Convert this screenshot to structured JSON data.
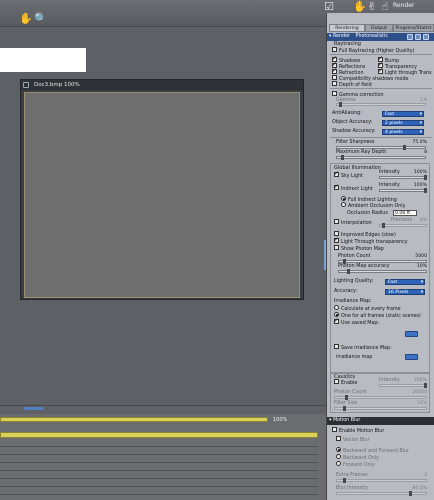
{
  "toolbar": {
    "title": "Render",
    "icons": [
      "hand-icon",
      "zoom-icon",
      "pose-hand-icon",
      "pose-hand-2-icon",
      "pose-hand-3-icon",
      "check-icon"
    ]
  },
  "document": {
    "title": "Doc3.bmp 100%"
  },
  "timeline": {
    "percent": "100%"
  },
  "panel": {
    "tabs": [
      "Rendering",
      "Output",
      "Progress/Statist"
    ],
    "header": "Render",
    "header_mode": "Photorealistic",
    "raytracing": {
      "title": "Raytracing",
      "full_raytracing": "Full Raytracing (Higher Quality)",
      "shadows": "Shadows",
      "bump": "Bump",
      "reflections": "Reflections",
      "transparency": "Transparency",
      "refraction": "Refraction",
      "light_through_trans": "Light through Trans",
      "compat_shadows": "Compatibility shadows mode",
      "depth_of_field": "Depth of field"
    },
    "gamma": {
      "label": "Gamma correction",
      "value_label": "Gamma:",
      "value": "1.8"
    },
    "antialiasing": {
      "label": "AntiAliasing:",
      "value": "Fast"
    },
    "object_accuracy": {
      "label": "Object Accuracy:",
      "value": "2 pixels"
    },
    "shadow_accuracy": {
      "label": "Shadow Accuracy:",
      "value": "4 pixels"
    },
    "filter_sharpness": {
      "label": "Filter Sharpness",
      "value": "75.0%"
    },
    "max_ray_depth": {
      "label": "Maximum Ray Depth",
      "value": "8"
    },
    "global_illum": {
      "title": "Global Illumination",
      "sky_light": "Sky Light",
      "intensity_label": "Intensity",
      "sky_intensity": "100%",
      "indirect_light": "Indirect Light",
      "indirect_intensity": "100%",
      "full_indirect": "Full Indirect Lighting",
      "ambient_occlusion": "Ambient Occlusion Only",
      "occlusion_radius_label": "Occlusion Radius",
      "occlusion_radius": "0.08 ft",
      "interpolation": "Interpolation",
      "precision_label": "Precision",
      "precision_value": "4%",
      "improved_edges": "Improved Edges (slow)",
      "light_through_transparency": "Light Through transparency",
      "show_photon_map": "Show Photon Map",
      "photon_count_label": "Photon Count",
      "photon_count": "5000",
      "photon_map_accuracy_label": "Photon Map accuracy",
      "photon_map_accuracy": "10%",
      "lighting_quality_label": "Lighting Quality:",
      "lighting_quality": "Fast",
      "accuracy_label": "Accuracy:",
      "accuracy": "16 Pixels",
      "irradiance_map": "Irradiance Map:",
      "calc_every_frame": "Calculate at every frame",
      "one_for_all": "One for all frames (static scenes)",
      "use_saved_map": "Use saved Map:",
      "save_irradiance": "Save irradiance Map:",
      "irradiance_map_name": "irradiance map"
    },
    "caustics": {
      "title": "Caustics",
      "enable": "Enable",
      "intensity_label": "Intensity",
      "intensity": "100%",
      "photon_count_label": "Photon Count",
      "photon_count": "20000",
      "filter_size_label": "Filter Size",
      "filter_size": "10%"
    },
    "motion_blur": {
      "title": "Motion Blur",
      "enable": "Enable Motion Blur",
      "vector_blur": "Vector Blur",
      "backward_forward": "Backward and Forward Blur",
      "backward_only": "Backward Only",
      "forward_only": "Forward Only",
      "extra_frames_label": "Extra Frames",
      "extra_frames": "3",
      "blur_intensity_label": "Blur Intensity",
      "blur_intensity": "80.0%"
    }
  }
}
